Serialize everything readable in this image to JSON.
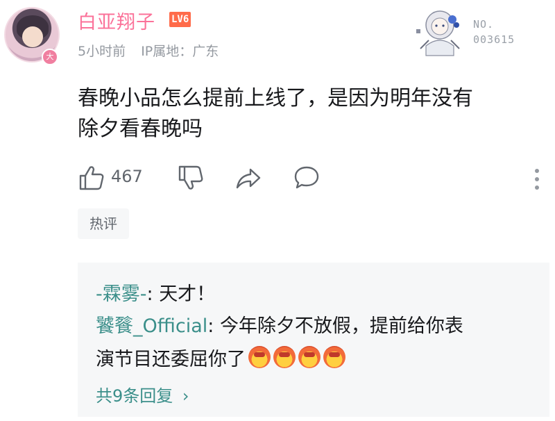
{
  "comment": {
    "username": "白亚翔子",
    "level_badge": "LV6",
    "time": "5小时前",
    "ip_location": "IP属地：广东",
    "text_line1": "春晚小品怎么提前上线了，是因为明年没有",
    "text_line2": "除夕看春晚吗",
    "avatar_badge": "大"
  },
  "decoration_card": {
    "no_label": "NO.",
    "number": "003615"
  },
  "actions": {
    "like_count": "467"
  },
  "tag": {
    "label": "热评"
  },
  "replies": {
    "items": [
      {
        "user": "-霖雾-",
        "separator": ": ",
        "text": "天才！"
      },
      {
        "user": "饕餮_Official",
        "separator": ": ",
        "text_line1": "今年除夕不放假，提前给你表",
        "text_line2": "演节目还委屈你了"
      }
    ],
    "emoji_name": "angry-face-emoji",
    "emoji_count": 4,
    "more_label": "共9条回复",
    "more_chevron": "›"
  },
  "colors": {
    "username": "#fb7299",
    "reply_user": "#3b8f8a",
    "meta": "#9499a0",
    "level_badge_bg": "#ff6b4a",
    "reply_bg": "#f6f7f8"
  }
}
